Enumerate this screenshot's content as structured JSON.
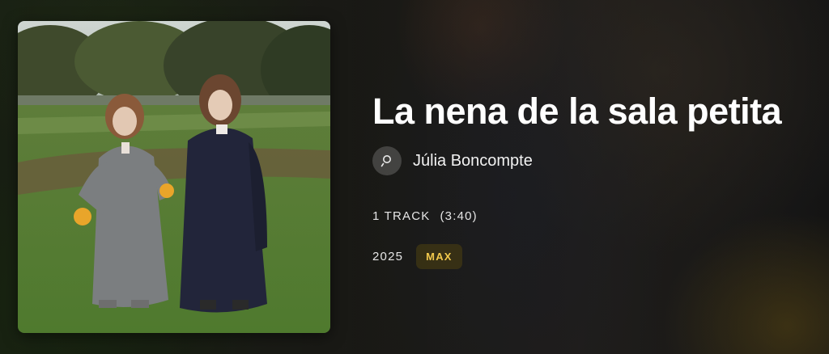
{
  "album": {
    "title": "La nena de la sala petita",
    "artist": "Júlia Boncompte",
    "track_count": "1 TRACK",
    "duration": "(3:40)",
    "year": "2025",
    "quality_badge": "MAX",
    "cover_description_icon": "album-cover-image"
  },
  "icons": {
    "artist_avatar": "person-icon"
  },
  "colors": {
    "badge_text": "#f2c94c",
    "badge_bg": "#3c3414",
    "text_primary": "#ffffff"
  }
}
